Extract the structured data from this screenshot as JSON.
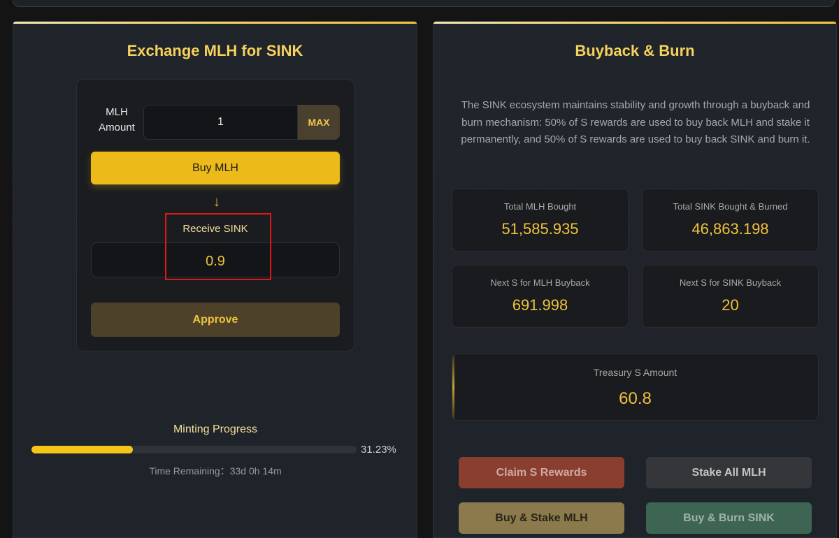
{
  "exchange": {
    "title": "Exchange MLH for SINK",
    "amount_label": "MLH Amount",
    "amount_value": "1",
    "max_label": "MAX",
    "buy_label": "Buy MLH",
    "arrow": "↓",
    "receive_label": "Receive SINK",
    "receive_value": "0.9",
    "approve_label": "Approve"
  },
  "progress": {
    "title": "Minting Progress",
    "percent_text": "31.23%",
    "fraction": 0.3123,
    "time_remaining": "Time Remaining：33d 0h 14m"
  },
  "buyback": {
    "title": "Buyback & Burn",
    "description": "The SINK ecosystem maintains stability and growth through a buyback and burn mechanism: 50% of S rewards are used to buy back MLH and stake it permanently, and 50% of S rewards are used to buy back SINK and burn it.",
    "stats": [
      {
        "label": "Total MLH Bought",
        "value": "51,585.935"
      },
      {
        "label": "Total SINK Bought & Burned",
        "value": "46,863.198"
      },
      {
        "label": "Next S for MLH Buyback",
        "value": "691.998"
      },
      {
        "label": "Next S for SINK Buyback",
        "value": "20"
      }
    ],
    "treasury": {
      "label": "Treasury S Amount",
      "value": "60.8"
    },
    "actions": {
      "claim": "Claim S Rewards",
      "stake": "Stake All MLH",
      "buy_stake": "Buy & Stake MLH",
      "buy_burn": "Buy & Burn SINK"
    }
  },
  "colors": {
    "accent": "#f0c23a",
    "highlight": "#e01818"
  }
}
